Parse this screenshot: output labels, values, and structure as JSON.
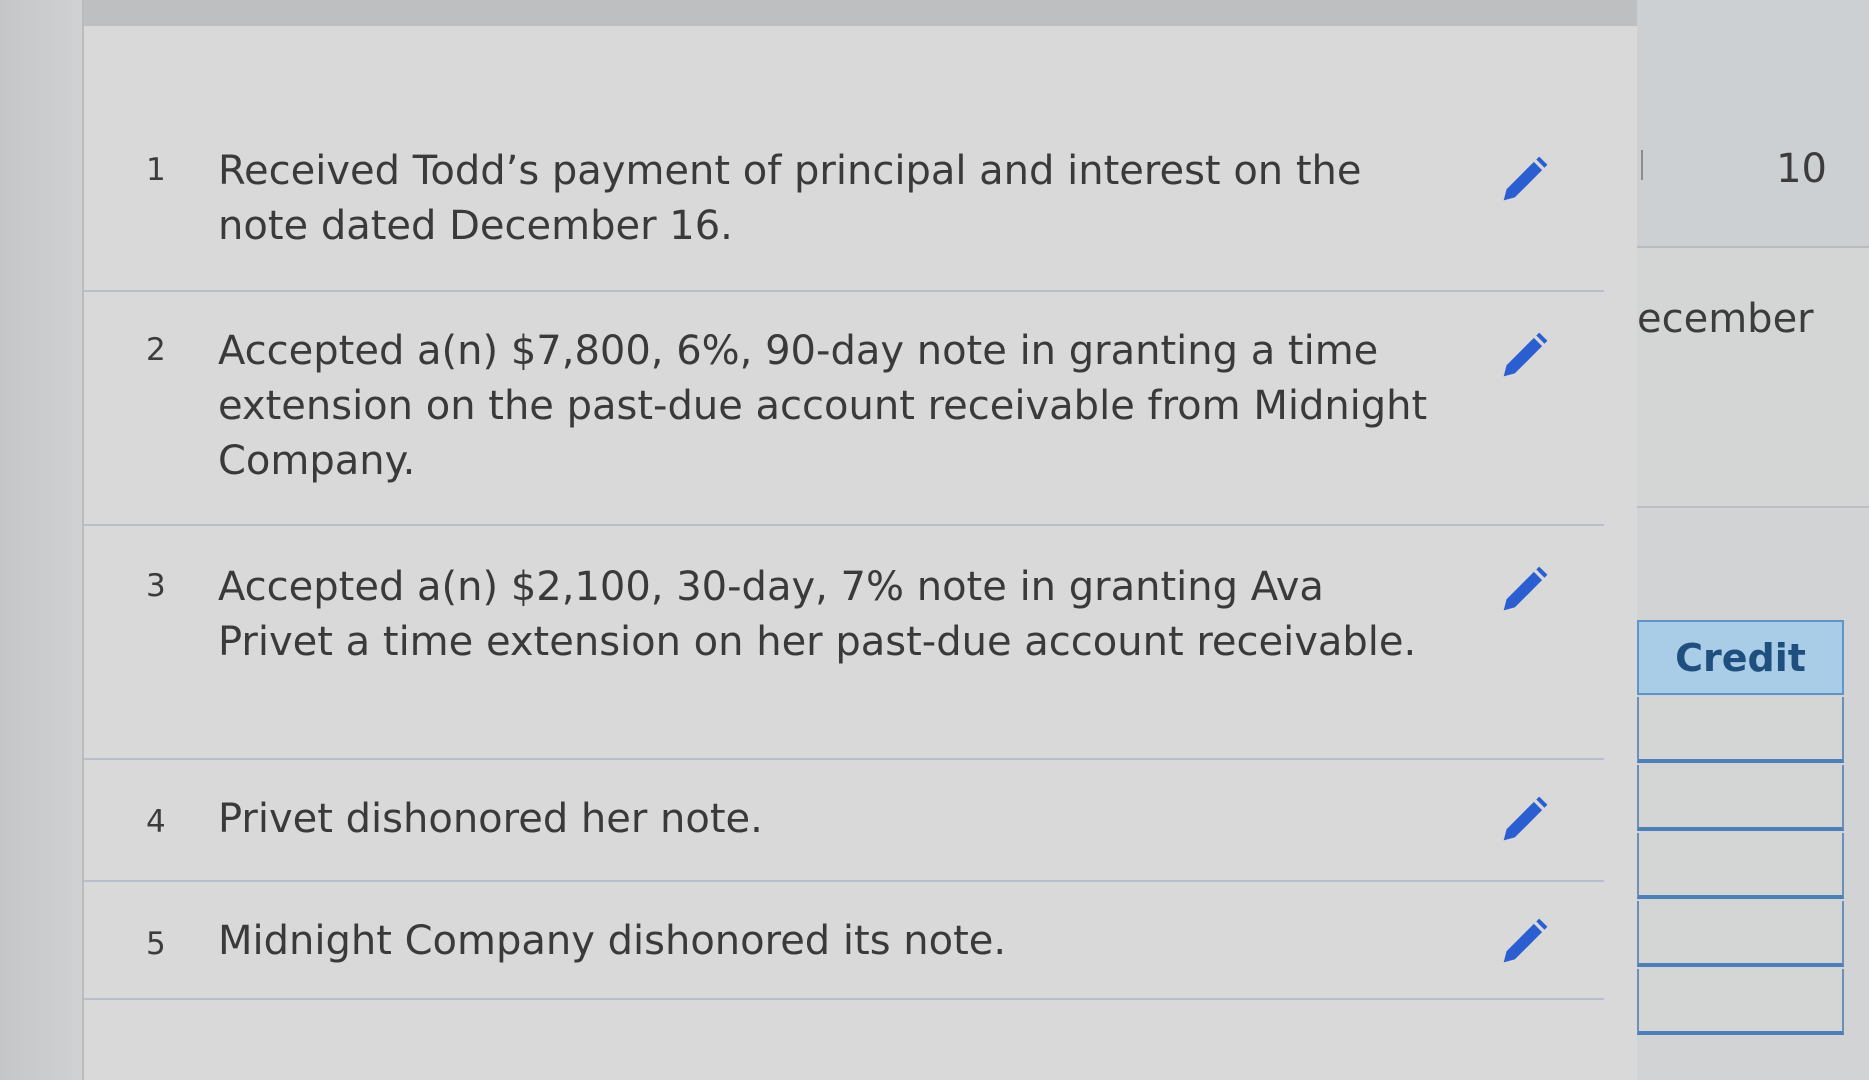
{
  "rows": [
    {
      "num": "1",
      "text": "Received Todd’s payment of principal and interest on the note dated December 16."
    },
    {
      "num": "2",
      "text": "Accepted a(n) $7,800, 6%, 90-day note in granting a time extension on the past-due account receivable from Midnight Company."
    },
    {
      "num": "3",
      "text": "Accepted a(n) $2,100, 30-day, 7% note in granting Ava Privet a time extension on her past-due account receivable."
    },
    {
      "num": "4",
      "text": "Privet dishonored her note."
    },
    {
      "num": "5",
      "text": "Midnight Company dishonored its note."
    }
  ],
  "right_panel": {
    "day": "10",
    "month": "ecember",
    "credit_header": "Credit"
  },
  "icons": {
    "edit": "pencil-icon",
    "edit_color": "#2b5fd1"
  }
}
